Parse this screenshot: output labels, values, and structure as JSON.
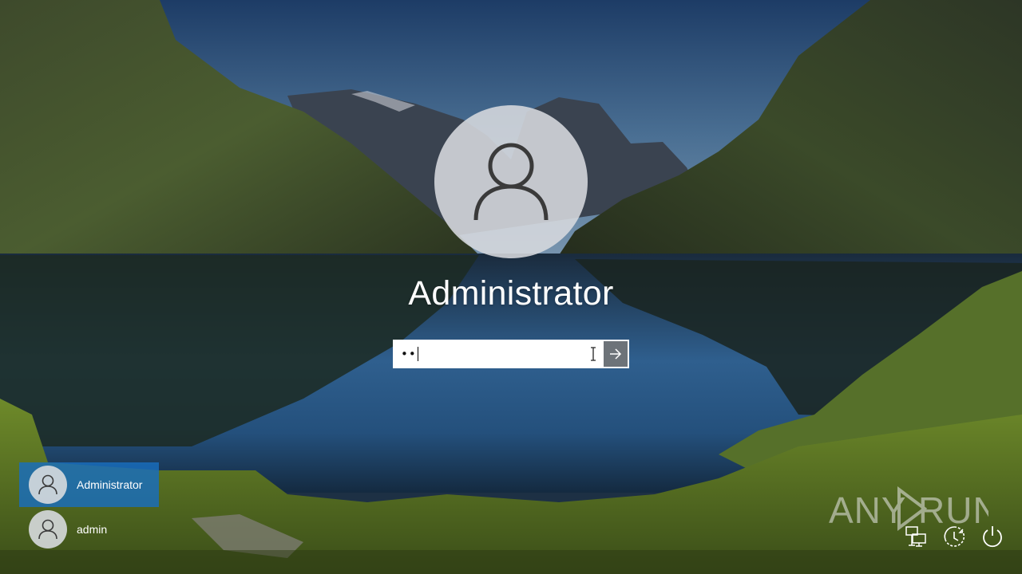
{
  "login": {
    "username": "Administrator",
    "password_masked": "••",
    "submit_icon": "arrow-right-icon"
  },
  "users": [
    {
      "name": "Administrator",
      "selected": true
    },
    {
      "name": "admin",
      "selected": false
    }
  ],
  "watermark": {
    "left": "ANY",
    "right": "RUN"
  },
  "system_icons": [
    "network-icon",
    "ease-of-access-icon",
    "power-icon"
  ],
  "colors": {
    "selected_user_bg": "#186ebe",
    "submit_button_bg": "#6d7379",
    "avatar_bg": "#d7dade"
  }
}
